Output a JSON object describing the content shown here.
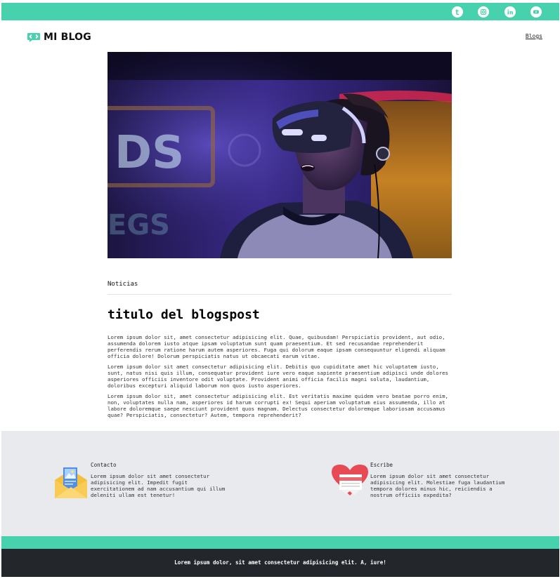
{
  "social": [
    {
      "icon": "tumblr-icon",
      "glyph": "t"
    },
    {
      "icon": "instagram-icon",
      "glyph": "ig"
    },
    {
      "icon": "linkedin-icon",
      "glyph": "in"
    },
    {
      "icon": "youtube-icon",
      "glyph": "yt"
    }
  ],
  "brand": {
    "name": "MI BLOG",
    "logo_icon": "code-chat-logo-icon"
  },
  "nav": {
    "blogs_label": "Blogs"
  },
  "hero": {
    "icon": "vr-headset-photo"
  },
  "post": {
    "category": "Noticias",
    "title": "titulo del blogspost",
    "paragraphs": [
      "Lorem ipsum dolor sit, amet consectetur adipisicing elit. Quae, quibusdam! Perspiciatis provident, aut odio, assumenda dolorem iusto atque ipsam voluptatum sunt quam praesentium. Et sed recusandae reprehenderit perferendis rerum ratione harum autem asperiores. Fuga qui dolorum eaque ipsam consequuntur eligendi aliquam officia dolore! Dolorum perspiciatis natus ut obcaecati earum vitae.",
      "Lorem ipsum dolor sit amet consectetur adipisicing elit. Debitis quo cupiditate amet hic voluptatem iusto, sunt, natus nisi quis illum, consequatur provident iure vero eaque sapiente praesentium adipisci unde dolores asperiores officiis inventore odit voluptate. Provident animi officia facilis magni soluta, laudantium, doloribus excepturi aliquid laborum non quos iusto asperiores.",
      "Lorem ipsum dolor sit, amet consectetur adipisicing elit. Est veritatis maxime quidem vero beatae porro enim, non, voluptates nulla nam, asperiores id harum corrupti ex! Sequi aperiam voluptatum eius assumenda, illo at labore doloremque saepe nesciunt provident quos magnam. Delectus consectetur doloremque laboriosam accusamus quae? Perspiciatis, consectetur? Autem, tempora reprehenderit?"
    ]
  },
  "contact": {
    "title": "Contacto",
    "text": "Lorem ipsum dolor sit amet consectetur adipisicing elit. Impedit fugit exercitationem ad nam accusantium qui illum deleniti ullam est tenetur!",
    "icon": "envelope-icon"
  },
  "write": {
    "title": "Escribe",
    "text": "Lorem ipsum dolor sit amet consectetur adipisicing elit. Molestiae fuga laudantium tempora dolores minus hic, reiciendis a nostrum officiis expedita?",
    "icon": "heart-document-icon"
  },
  "footer": {
    "text": "Lorem ipsum dolor, sit amet consectetur adipisicing elit. A, iure!"
  },
  "colors": {
    "accent": "#47d1ad",
    "dark": "#23272b",
    "info_bg": "#e8eaee",
    "heart": "#e84a55"
  }
}
